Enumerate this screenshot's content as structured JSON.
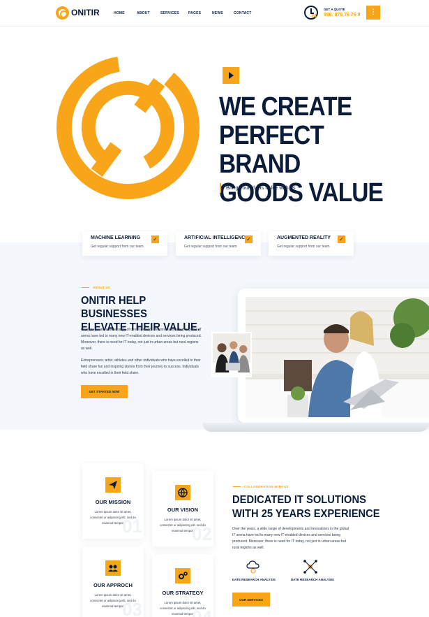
{
  "header": {
    "logo_text": "ONITIR",
    "nav": [
      "HOME",
      "ABOUT",
      "SERVICES",
      "PAGES",
      "NEWS",
      "CONTACT"
    ],
    "clock_badge": "24",
    "quote_label": "GET A QUOTE",
    "quote_phone": "986. 876 76 76 8",
    "menu_icon": "⋮"
  },
  "hero": {
    "title_lines": [
      "WE CREATE",
      "PERFECT BRAND",
      "GOODS VALUE"
    ],
    "subtitle": "Bring your ideas to life with us"
  },
  "features": [
    {
      "title": "MACHINE LEARNING",
      "text": "Get regular support from our team"
    },
    {
      "title": "ARTIFICIAL INTELLIGENCE",
      "text": "Get regular support from our team"
    },
    {
      "title": "AUGMENTED REALITY",
      "text": "Get regular support from our team"
    }
  ],
  "about": {
    "eyebrow": "ABOUT US",
    "title_lines": [
      "ONITIR HELP BUSINESSES",
      "ELEVATE THEIR VALUE."
    ],
    "para1": "Over the years, a wide range of developments and innovations in the global IT arena have led to many new IT-enabled devices and services being produced. Moreover, there is need for IT today, not just in urban areas but rural regions as well.",
    "para2": "Entrepreneurs, artist, athletes and other individuals who have excelled in their field share fun and inspiring stories from their journey to success. Individuals who have excelled in their field share.",
    "button": "GET STARTED NOW"
  },
  "cards": [
    {
      "title": "OUR MISSION",
      "text": "Lorem ipsum dolor sit amet, consectet ur adipiscing elit, sed do eiusmod tempor.",
      "num": "01",
      "icon": "paper-plane-icon"
    },
    {
      "title": "OUR VISION",
      "text": "Lorem ipsum dolor sit amet, consectet ur adipiscing elit, sed do eiusmod tempor.",
      "num": "02",
      "icon": "globe-icon"
    },
    {
      "title": "OUR APPROCH",
      "text": "Lorem ipsum dolor sit amet, consectet ur adipiscing elit, sed do eiusmod tempor.",
      "num": "03",
      "icon": "users-icon"
    },
    {
      "title": "OUR STRATEGY",
      "text": "Lorem ipsum dolor sit amet, consectet ur adipiscing elit, sed do eiusmod tempor.",
      "num": "04",
      "icon": "gears-icon"
    }
  ],
  "collab": {
    "eyebrow": "COLLABORATION WITH US",
    "title_lines": [
      "DEDICATED IT SOLUTIONS",
      "WITH 25 YEARS EXPERIENCE"
    ],
    "para": "Over the years, a wide range of developments and innovations in the global IT arena have led to many new IT-enabled devices and services being produced. Moreover, there is need for IT today, not just in urban areas but rural regions as well.",
    "services": [
      "DATE RESEARCH ANALYSIS",
      "DATE RESEARCH ANALYSIS"
    ],
    "button": "OUR SERVICES"
  },
  "colors": {
    "accent": "#f9a51a",
    "navy": "#0b1c3a",
    "band": "#f4f8fd"
  }
}
